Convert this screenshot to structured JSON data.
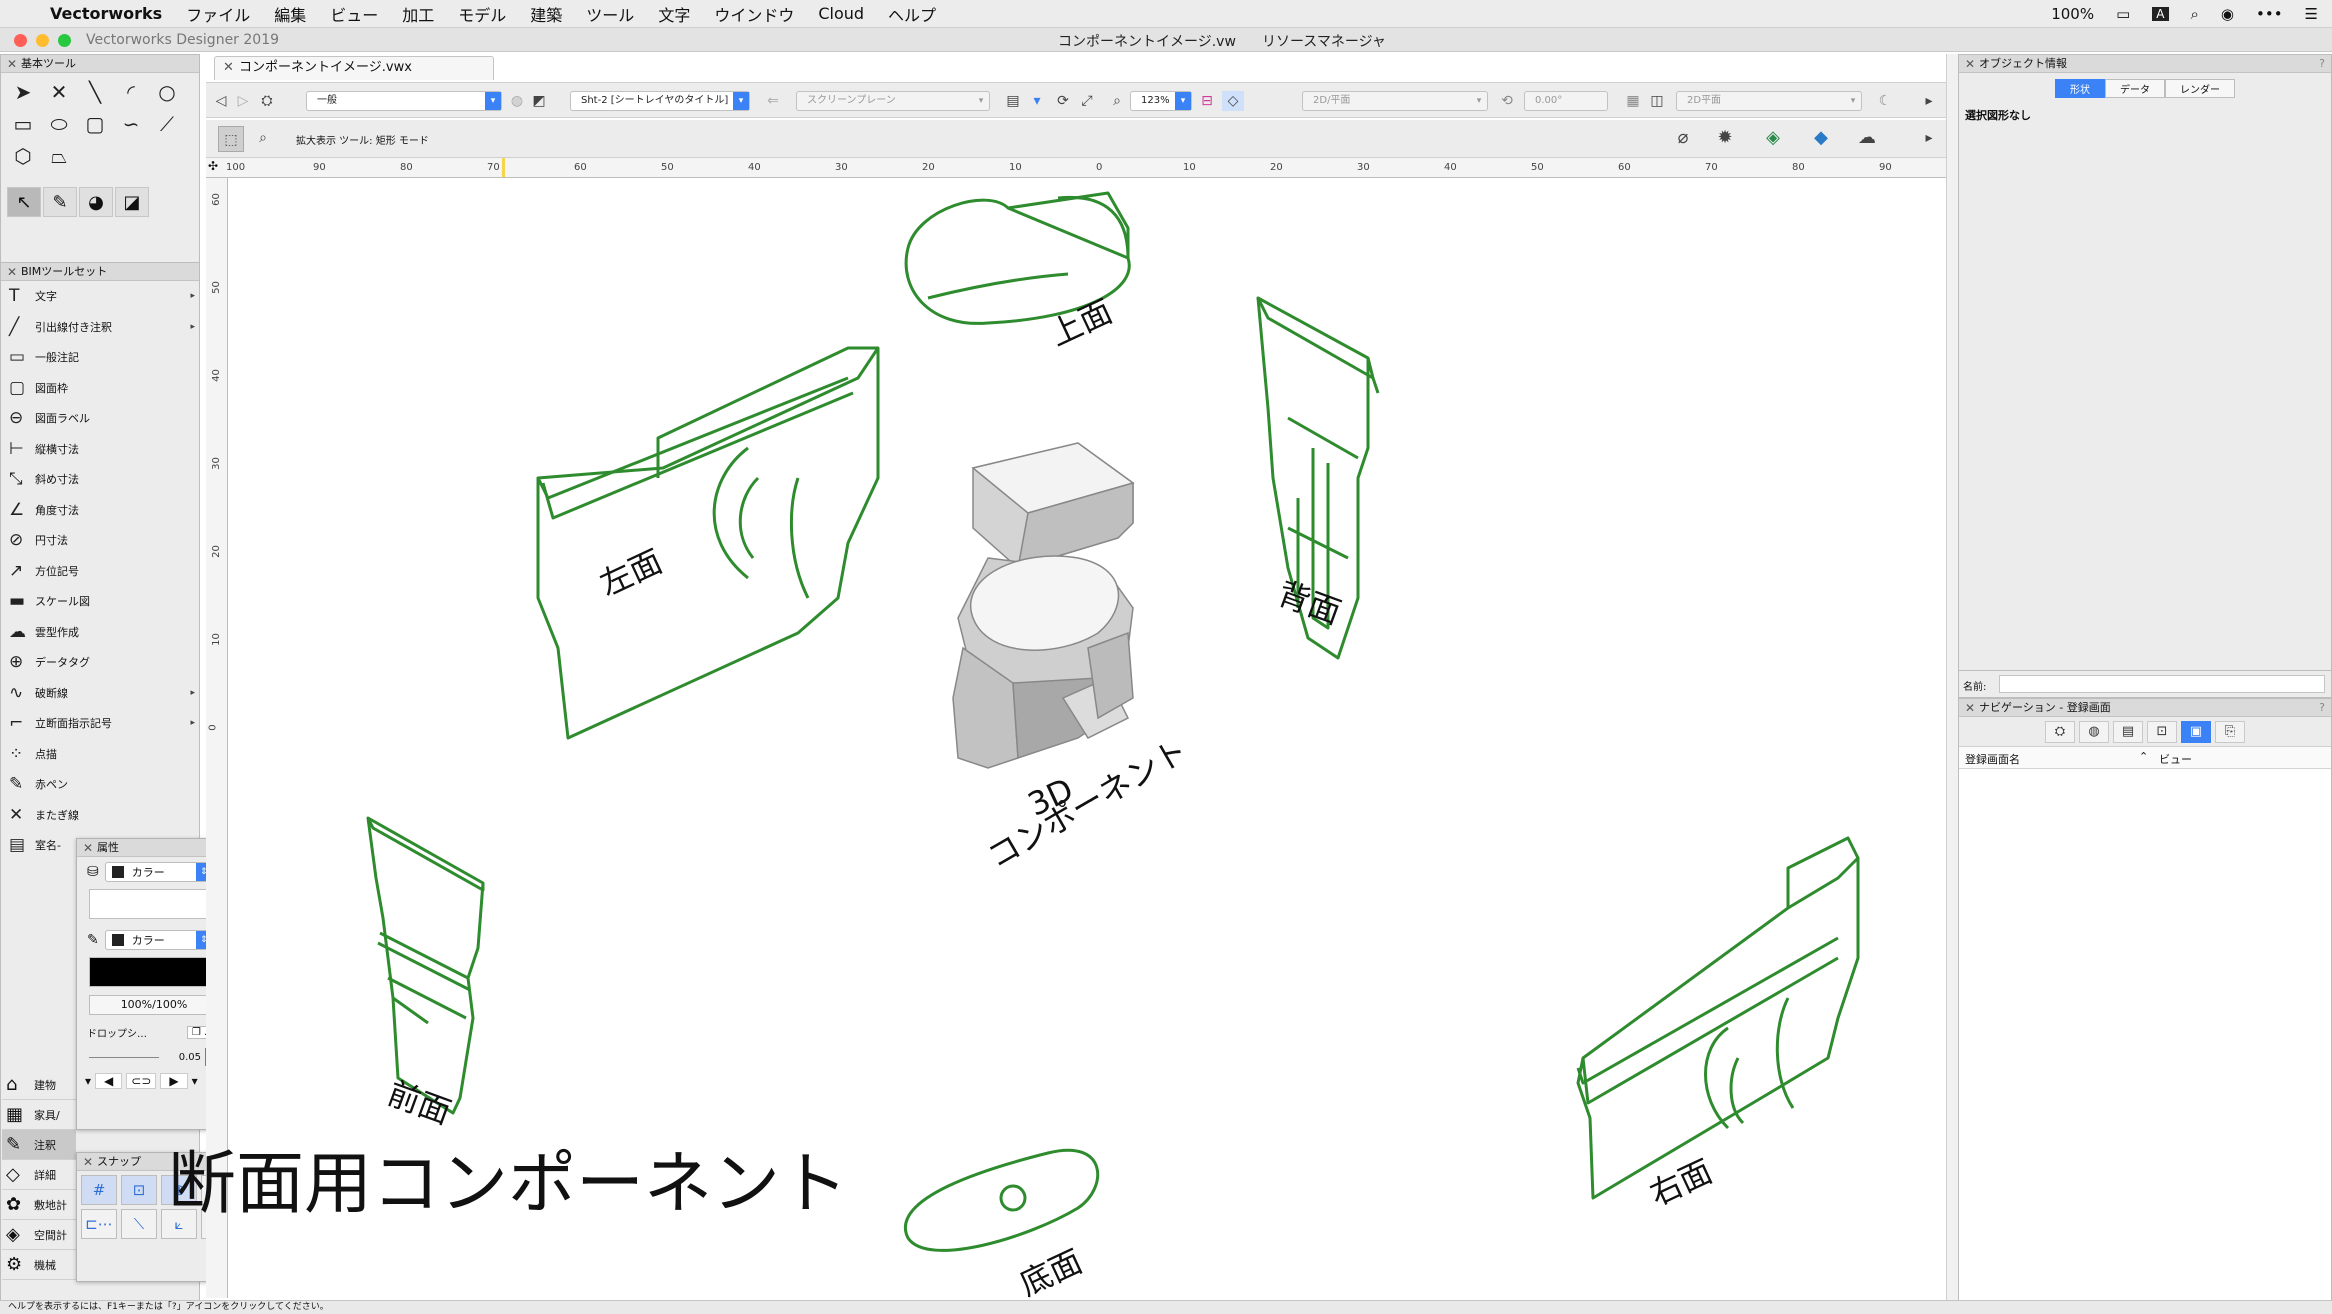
{
  "menubar": {
    "app_name": "Vectorworks",
    "items": [
      "ファイル",
      "編集",
      "ビュー",
      "加工",
      "モデル",
      "建築",
      "ツール",
      "文字",
      "ウインドウ",
      "Cloud",
      "ヘルプ"
    ],
    "battery": "100%"
  },
  "window": {
    "app_title": "Vectorworks Designer 2019",
    "doc_title": "コンポーネントイメージ.vw",
    "resource_title": "リソースマネージャ"
  },
  "tab": {
    "label": "コンポーネントイメージ.vwx"
  },
  "basic_tools": {
    "title": "基本ツール"
  },
  "bim_tools": {
    "title": "BIMツールセット",
    "items": [
      {
        "label": "文字",
        "icon": "T",
        "sub": true
      },
      {
        "label": "引出線付き注釈",
        "icon": "╱",
        "sub": true
      },
      {
        "label": "一般注記",
        "icon": "▭",
        "sub": false
      },
      {
        "label": "図面枠",
        "icon": "▢",
        "sub": false
      },
      {
        "label": "図面ラベル",
        "icon": "⊖",
        "sub": false
      },
      {
        "label": "縦横寸法",
        "icon": "⊢",
        "sub": false
      },
      {
        "label": "斜め寸法",
        "icon": "⤡",
        "sub": false
      },
      {
        "label": "角度寸法",
        "icon": "∠",
        "sub": false
      },
      {
        "label": "円寸法",
        "icon": "⊘",
        "sub": false
      },
      {
        "label": "方位記号",
        "icon": "↗",
        "sub": false
      },
      {
        "label": "スケール図",
        "icon": "▬",
        "sub": false
      },
      {
        "label": "雲型作成",
        "icon": "☁",
        "sub": false
      },
      {
        "label": "データタグ",
        "icon": "⊕",
        "sub": false
      },
      {
        "label": "破断線",
        "icon": "∿",
        "sub": true
      },
      {
        "label": "立断面指示記号",
        "icon": "⌐",
        "sub": true
      },
      {
        "label": "点描",
        "icon": "⁘",
        "sub": false
      },
      {
        "label": "赤ペン",
        "icon": "✎",
        "sub": false
      },
      {
        "label": "またぎ線",
        "icon": "✕",
        "sub": false
      },
      {
        "label": "室名-",
        "icon": "▤",
        "sub": false
      }
    ]
  },
  "categories": [
    {
      "label": "建物",
      "icon": "⌂"
    },
    {
      "label": "家具/",
      "icon": "▦"
    },
    {
      "label": "注釈",
      "icon": "✎"
    },
    {
      "label": "詳細",
      "icon": "◇"
    },
    {
      "label": "敷地計",
      "icon": "✿"
    },
    {
      "label": "空間計",
      "icon": "◈"
    },
    {
      "label": "機械",
      "icon": "⚙"
    }
  ],
  "attributes": {
    "title": "属性",
    "fill_label": "カラー",
    "pen_label": "カラー",
    "opacity": "100%/100%",
    "drop_shadow": "ドロップシ…",
    "line_weight": "0.05"
  },
  "snapping": {
    "title": "スナップ"
  },
  "view_bar": {
    "class": "一般",
    "layer": "Sht-2 [シートレイヤのタイトル]",
    "plane": "スクリーンプレーン",
    "zoom": "123%",
    "view": "2D/平面",
    "angle": "0.00°",
    "render": "2D平面"
  },
  "mode_bar": {
    "text": "拡大表示 ツール: 矩形 モード"
  },
  "ruler": {
    "top_labels": [
      "100",
      "90",
      "80",
      "70",
      "60",
      "50",
      "40",
      "30",
      "20",
      "10",
      "0",
      "10",
      "20",
      "30",
      "40",
      "50",
      "60",
      "70",
      "80",
      "90"
    ],
    "left_labels": [
      "60",
      "50",
      "40",
      "30",
      "20",
      "10",
      "0"
    ]
  },
  "drawing": {
    "label_top": "上面",
    "label_left": "左面",
    "label_back": "背面",
    "label_3d_1": "3D",
    "label_3d_2": "コンポーネント",
    "label_front": "前面",
    "label_right": "右面",
    "label_bottom": "底面",
    "caption": "断面用コンポーネント",
    "line_color": "#2e8b2e"
  },
  "object_info": {
    "title": "オブジェクト情報",
    "tabs": [
      "形状",
      "データ",
      "レンダー"
    ],
    "none_selected": "選択図形なし",
    "name_label": "名前:"
  },
  "navigation": {
    "title": "ナビゲーション - 登録画面",
    "col_name": "登録画面名",
    "col_view": "ビュー"
  },
  "status": "ヘルプを表示するには、F1キーまたは「?」アイコンをクリックしてください。"
}
